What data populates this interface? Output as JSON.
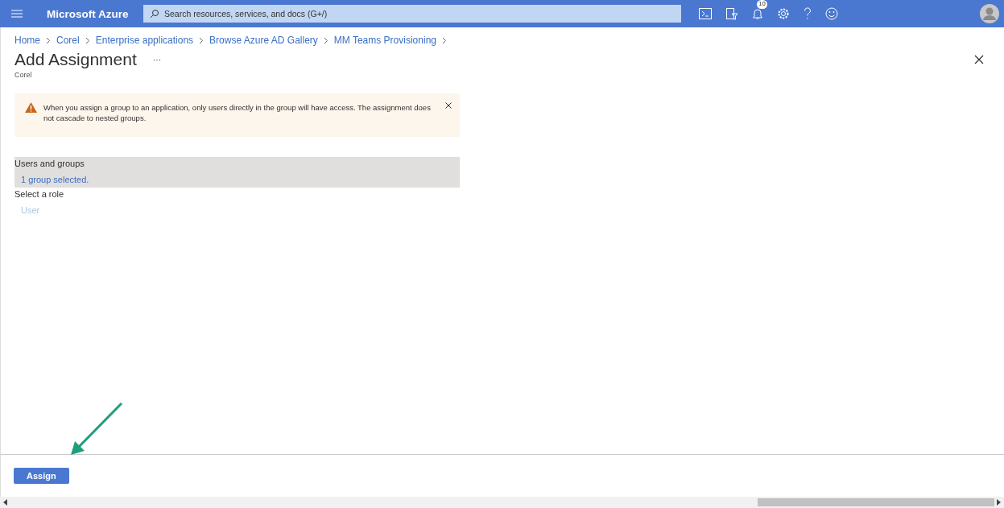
{
  "topbar": {
    "brand": "Microsoft Azure",
    "search": {
      "placeholder": "Search resources, services, and docs (G+/)"
    },
    "notifications_badge": "10"
  },
  "breadcrumb": [
    "Home",
    "Corel",
    "Enterprise applications",
    "Browse Azure AD Gallery",
    "MM Teams Provisioning"
  ],
  "page": {
    "title": "Add Assignment",
    "more": "···",
    "subtitle": "Corel"
  },
  "warning": {
    "text": "When you assign a group to an application, only users directly in the group will have access. The assignment does not cascade to nested groups."
  },
  "sections": [
    {
      "label": "Users and groups",
      "value": "1 group selected.",
      "selected": true
    },
    {
      "label": "Select a role",
      "value": "User",
      "selected": false
    }
  ],
  "footer": {
    "button": "Assign"
  }
}
